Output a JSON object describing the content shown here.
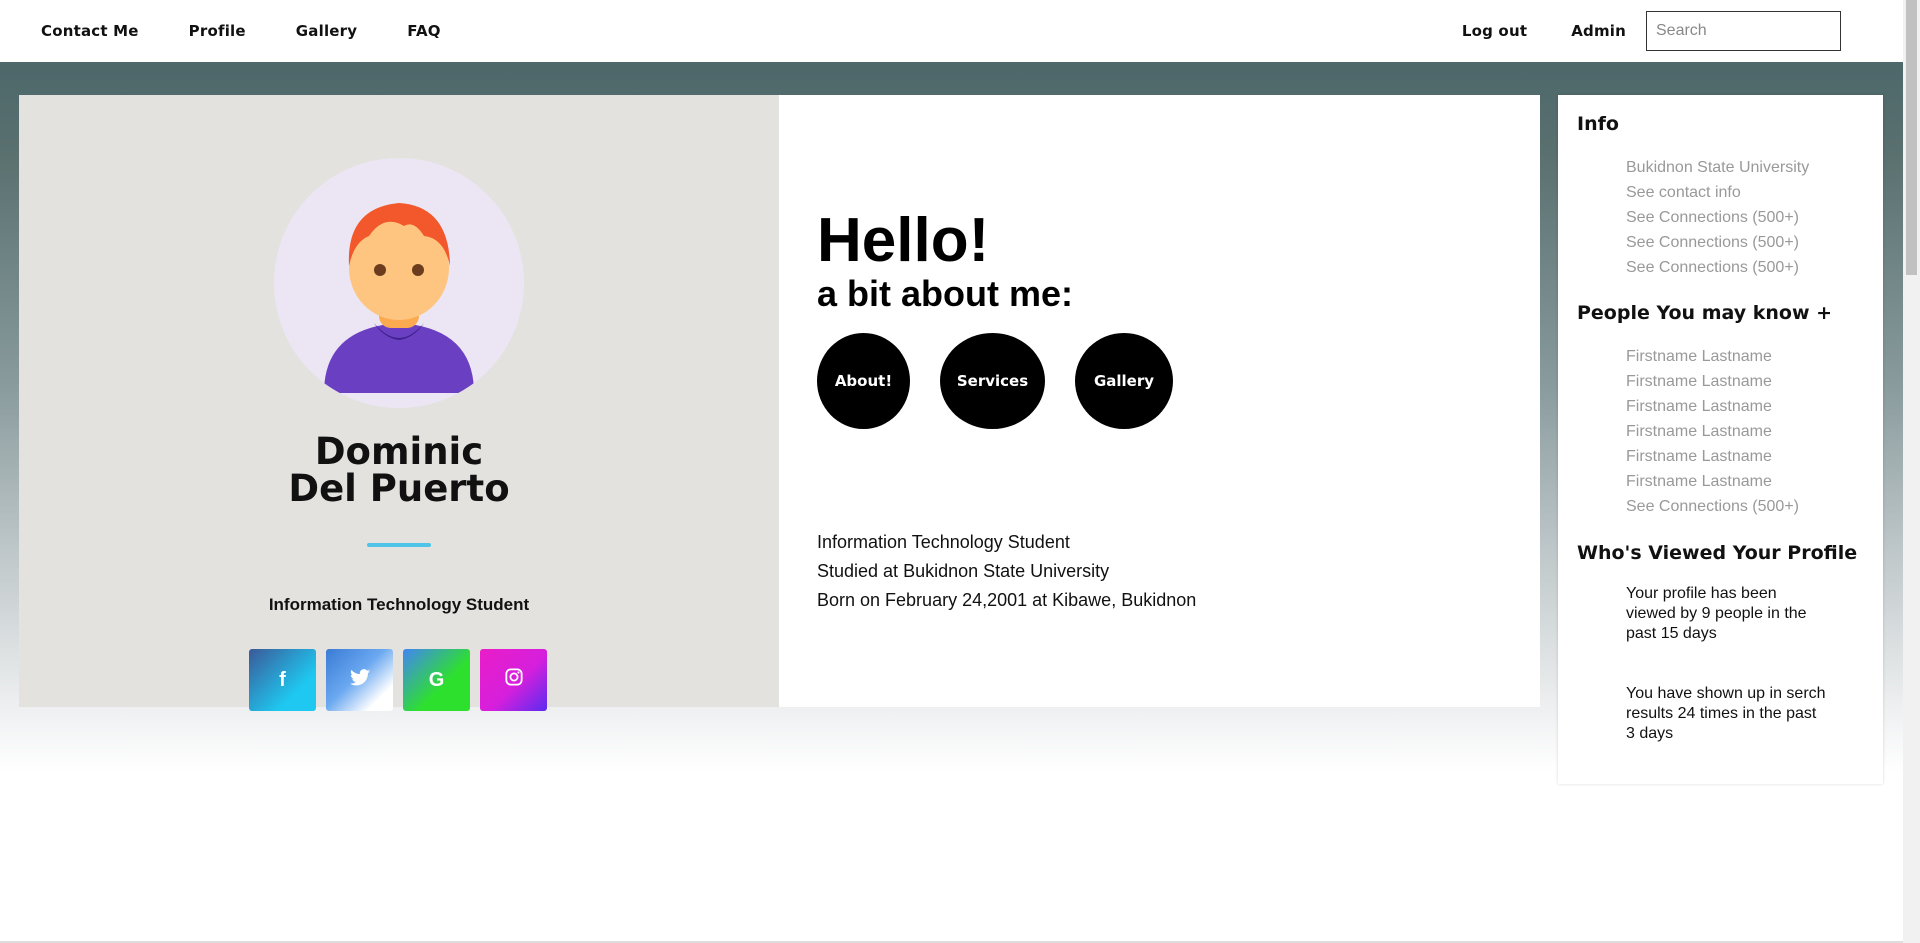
{
  "nav": {
    "left": [
      "Contact Me",
      "Profile",
      "Gallery",
      "FAQ"
    ],
    "logout": "Log out",
    "admin": "Admin",
    "search_placeholder": "Search"
  },
  "profile": {
    "name_line1": "Dominic",
    "name_line2": "Del Puerto",
    "tagline": "Information Technology Student",
    "accent_color": "#4fc3e8",
    "socials": [
      {
        "icon": "facebook-icon",
        "glyph": "f"
      },
      {
        "icon": "twitter-icon",
        "glyph": "🐦"
      },
      {
        "icon": "google-icon",
        "glyph": "G"
      },
      {
        "icon": "instagram-icon",
        "glyph": "◎"
      }
    ]
  },
  "about": {
    "hello": "Hello!",
    "heading": "a bit about me:",
    "buttons": [
      "About!",
      "Services",
      "Gallery"
    ],
    "bio": [
      "Information Technology Student",
      "Studied at Bukidnon State University",
      "Born on February 24,2001 at Kibawe, Bukidnon"
    ]
  },
  "sidebar": {
    "info_title": "Info",
    "info_items": [
      "Bukidnon State University",
      "See contact info",
      "See Connections (500+)",
      "See Connections (500+)",
      "See Connections (500+)"
    ],
    "people_title": "People You may know +",
    "people_items": [
      "Firstname Lastname",
      "Firstname Lastname",
      "Firstname Lastname",
      "Firstname Lastname",
      "Firstname Lastname",
      "Firstname Lastname",
      "See Connections (500+)"
    ],
    "viewed_title": "Who's Viewed Your Profile",
    "viewed_text1": "Your profile has been viewed by 9 people in the past 15 days",
    "viewed_text2": "You have shown up in serch results 24 times in the past 3 days"
  }
}
